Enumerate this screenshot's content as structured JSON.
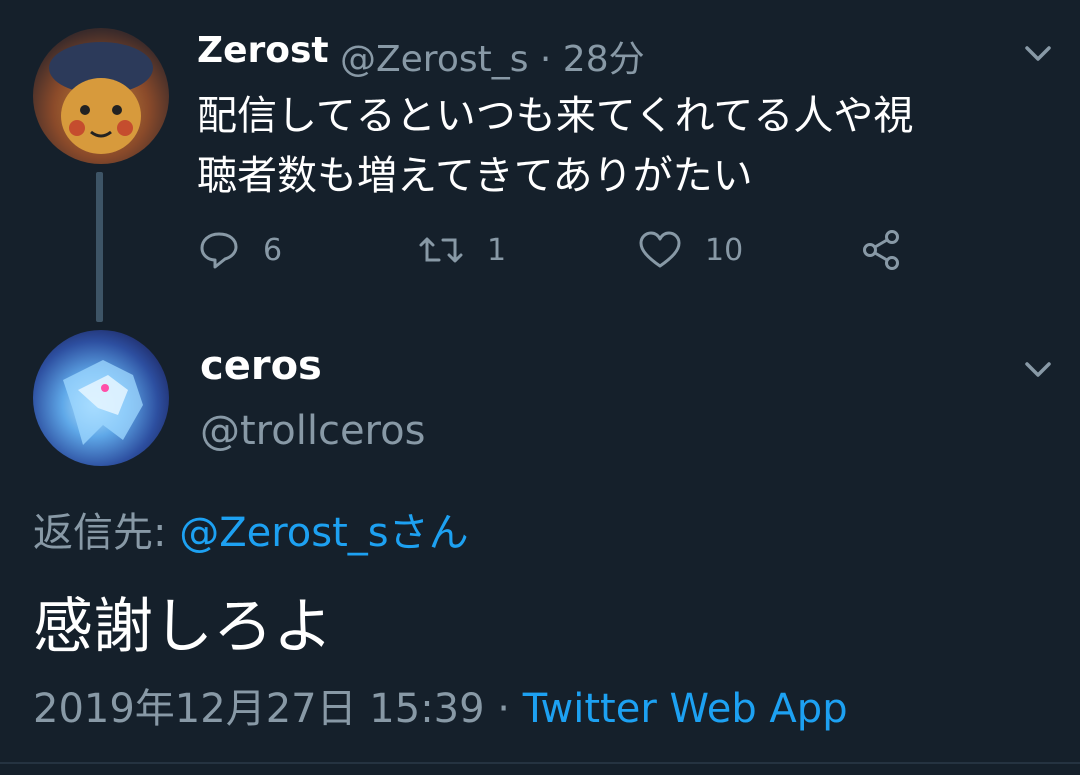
{
  "tweet1": {
    "name": "Zerost",
    "handle_time": "@Zerost_s · 28分",
    "text_line1": "配信してるといつも来てくれてる人や視",
    "text_line2": "聴者数も増えてきてありがたい",
    "replies": "6",
    "retweets": "1",
    "likes": "10"
  },
  "tweet2": {
    "name": "ceros",
    "handle": "@trollceros",
    "reply_prefix": "返信先: ",
    "reply_mention": "@Zerost_sさん",
    "text": "感謝しろよ",
    "timestamp": "2019年12月27日 15:39 · ",
    "source": "Twitter Web App"
  },
  "colors": {
    "background": "#15202b",
    "secondary_text": "#8899a6",
    "accent": "#1da1f2"
  }
}
